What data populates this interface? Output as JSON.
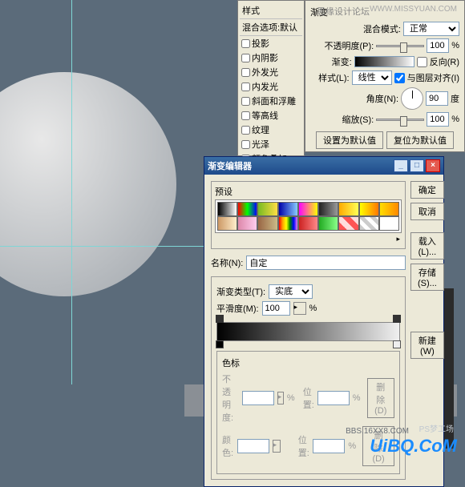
{
  "watermarks": {
    "top_text": "思缘设计论坛",
    "top_url": "WWW.MISSYUAN.COM",
    "logo": "UiBQ.CoM",
    "logo2": "PS梦工场",
    "wm2": "BBS.16XX8.COM"
  },
  "styles_panel": {
    "header": "样式",
    "blend_header": "混合选项:默认",
    "items": [
      "投影",
      "内阴影",
      "外发光",
      "内发光",
      "斜面和浮雕",
      "等高线",
      "纹理",
      "光泽",
      "颜色叠加"
    ]
  },
  "layer_style": {
    "header2": "渐变",
    "blend_mode_lbl": "混合模式:",
    "blend_mode": "正常",
    "opacity_lbl": "不透明度(P):",
    "opacity": "100",
    "opacity_unit": "%",
    "gradient_lbl": "渐变:",
    "reverse_lbl": "反向(R)",
    "style_lbl": "样式(L):",
    "style": "线性",
    "align_lbl": "与图层对齐(I)",
    "angle_lbl": "角度(N):",
    "angle": "90",
    "angle_unit": "度",
    "scale_lbl": "缩放(S):",
    "scale": "100",
    "scale_unit": "%",
    "set_default": "设置为默认值",
    "reset_default": "复位为默认值"
  },
  "dialog": {
    "title": "渐变编辑器",
    "presets_lbl": "预设",
    "ok": "确定",
    "cancel": "取消",
    "load": "载入(L)...",
    "save": "存储(S)...",
    "name_lbl": "名称(N):",
    "name": "自定",
    "new": "新建(W)",
    "type_lbl": "渐变类型(T):",
    "type": "实底",
    "smooth_lbl": "平滑度(M):",
    "smooth": "100",
    "smooth_unit": "%",
    "stops_header": "色标",
    "opacity_lbl": "不透明度:",
    "opacity_unit": "%",
    "pos_lbl": "位置:",
    "pos_unit": "%",
    "del": "删除(D)",
    "color_lbl": "颜色:"
  },
  "swatches": [
    "linear-gradient(90deg,#000,#fff)",
    "linear-gradient(90deg,#f00,#0f0,#00f)",
    "linear-gradient(90deg,#7b2,#fd4)",
    "linear-gradient(90deg,#00a,#8cf)",
    "linear-gradient(90deg,#f0f,#ff0)",
    "linear-gradient(90deg,#222,#999)",
    "linear-gradient(90deg,#fa0,#ff5)",
    "linear-gradient(90deg,#ff0,#f70)",
    "linear-gradient(90deg,#fd0,#f80)",
    "linear-gradient(90deg,#c96,#fec)",
    "linear-gradient(90deg,#d8a,#fce)",
    "linear-gradient(90deg,#964,#cb8)",
    "linear-gradient(90deg,red,orange,yellow,green,blue,violet)",
    "linear-gradient(90deg,#c22,#f88)",
    "linear-gradient(90deg,#2a2,#8f8)",
    "linear-gradient(45deg,#f55 25%,#fdd 25%,#fdd 50%,#f55 50%,#f55 75%,#fdd 75%)",
    "repeating-linear-gradient(45deg,#ccc 0 5px,#fff 5px 10px)",
    "linear-gradient(90deg,#fff,#fff)"
  ]
}
